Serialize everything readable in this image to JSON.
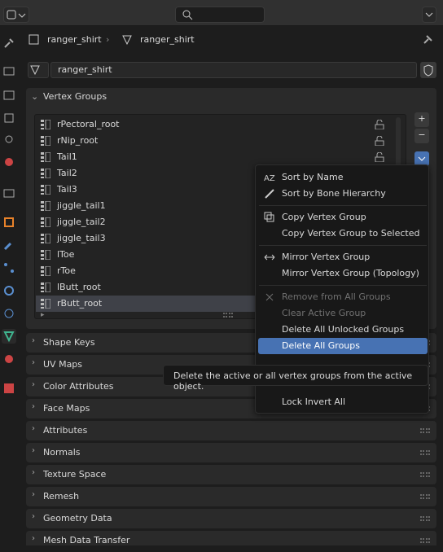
{
  "breadcrumb": {
    "object": "ranger_shirt",
    "mesh": "ranger_shirt"
  },
  "mesh_field": {
    "value": "ranger_shirt"
  },
  "vertex_groups_panel": {
    "title": "Vertex Groups"
  },
  "vertex_groups": [
    "rPectoral_root",
    "rNip_root",
    "Tail1",
    "Tail2",
    "Tail3",
    "jiggle_tail1",
    "jiggle_tail2",
    "jiggle_tail3",
    "lToe",
    "rToe",
    "lButt_root",
    "rButt_root"
  ],
  "list_buttons": {
    "add": "+",
    "remove": "−"
  },
  "context_menu": {
    "items": [
      {
        "label": "Sort by Name",
        "enabled": true
      },
      {
        "label": "Sort by Bone Hierarchy",
        "enabled": true
      },
      {
        "label": "Copy Vertex Group",
        "enabled": true
      },
      {
        "label": "Copy Vertex Group to Selected",
        "enabled": true
      },
      {
        "label": "Mirror Vertex Group",
        "enabled": true
      },
      {
        "label": "Mirror Vertex Group (Topology)",
        "enabled": true
      },
      {
        "label": "Remove from All Groups",
        "enabled": false
      },
      {
        "label": "Clear Active Group",
        "enabled": false
      },
      {
        "label": "Delete All Unlocked Groups",
        "enabled": true
      },
      {
        "label": "Delete All Groups",
        "enabled": true,
        "highlighted": true
      },
      {
        "label": "Lock Invert All",
        "enabled": true
      }
    ]
  },
  "tooltip": "Delete the active or all vertex groups from the active object.",
  "panels": [
    "Shape Keys",
    "UV Maps",
    "Color Attributes",
    "Face Maps",
    "Attributes",
    "Normals",
    "Texture Space",
    "Remesh",
    "Geometry Data",
    "Mesh Data Transfer"
  ],
  "colors": {
    "accent": "#4772b3",
    "background": "#1d1d1d",
    "panel": "#2a2a2a"
  }
}
